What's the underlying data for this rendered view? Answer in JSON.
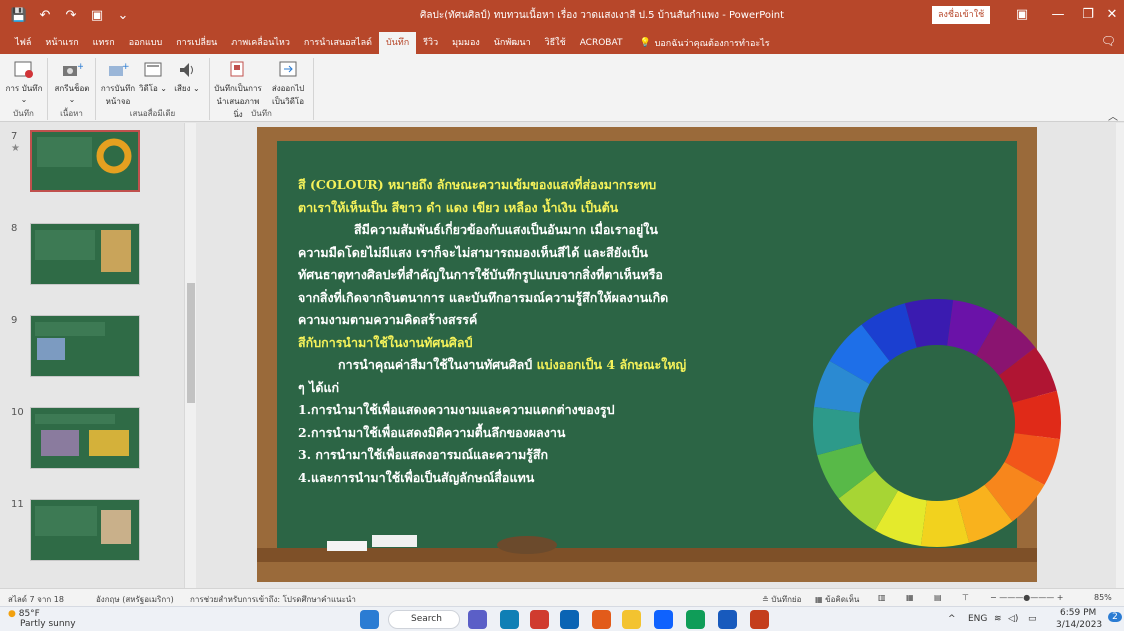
{
  "window": {
    "title": "ศิลปะ(ทัศนศิลป์) ทบทวนเนื้อหา เรื่อง วาดแสงเงาสี ป.5 บ้านสันกำแพง - PowerPoint",
    "signin": "ลงชื่อเข้าใช้",
    "quick_access": [
      "💾",
      "↶",
      "↷",
      "▣",
      "⌄"
    ],
    "controls": {
      "ribbon_display": "▣",
      "minimize": "—",
      "restore": "❐",
      "close": "✕"
    }
  },
  "tabs": [
    "ไฟล์",
    "หน้าแรก",
    "แทรก",
    "ออกแบบ",
    "การเปลี่ยน",
    "ภาพเคลื่อนไหว",
    "การนำเสนอสไลด์",
    "บันทึก",
    "รีวิว",
    "มุมมอง",
    "นักพัฒนา",
    "วิธีใช้",
    "ACROBAT"
  ],
  "active_tab_index": 7,
  "tell_me": "บอกฉันว่าคุณต้องการทำอะไร",
  "ribbon": {
    "groups": [
      {
        "label": "บันทึก",
        "buttons": [
          "การ บันทึก ⌄"
        ]
      },
      {
        "label": "เนื้อหา",
        "buttons": [
          "สกรีนช็อต ⌄"
        ]
      },
      {
        "label": "เสนอสื่อมีเดีย",
        "buttons": [
          "การบันทึก หน้าจอ",
          "วิดีโอ ⌄",
          "เสียง ⌄"
        ]
      },
      {
        "label": "บันทึก",
        "buttons": [
          "บันทึกเป็นการ นำเสนอภาพนิ่ง",
          "ส่งออกไป เป็นวิดีโอ"
        ]
      }
    ],
    "collapse": "︿"
  },
  "thumbnails": [
    {
      "number": "7",
      "star": "★",
      "selected": true
    },
    {
      "number": "8",
      "star": "",
      "selected": false
    },
    {
      "number": "9",
      "star": "",
      "selected": false
    },
    {
      "number": "10",
      "star": "",
      "selected": false
    },
    {
      "number": "11",
      "star": "",
      "selected": false
    }
  ],
  "slide": {
    "lines": [
      {
        "text": "สี (COLOUR) หมายถึง ลักษณะความเข้มของแสงที่ส่องมากระทบ",
        "style": "yellow"
      },
      {
        "text": "ตาเราให้เห็นเป็น สีขาว ดำ แดง เขียว เหลือง น้ำเงิน เป็นต้น",
        "style": "yellow"
      },
      {
        "text": "สีมีความสัมพันธ์เกี่ยวข้องกับแสงเป็นอันมาก เมื่อเราอยู่ใน",
        "style": "indent"
      },
      {
        "text": "ความมืดโดยไม่มีแสง เราก็จะไม่สามารถมองเห็นสีได้ และสียังเป็น",
        "style": "white"
      },
      {
        "text": "ทัศนธาตุทางศิลปะที่สำคัญในการใช้บันทึกรูปแบบจากสิ่งที่ตาเห็นหรือ",
        "style": "white"
      },
      {
        "text": "จากสิ่งที่เกิดจากจินตนาการ และบันทึกอารมณ์ความรู้สึกให้ผลงานเกิด",
        "style": "white"
      },
      {
        "text": "ความงามตามความคิดสร้างสรรค์",
        "style": "white"
      },
      {
        "text": "สีกับการนำมาใช้ในงานทัศนศิลป์",
        "style": "yellow"
      },
      {
        "text": "การนำคุณค่าสีมาใช้ในงานทัศนศิลป์",
        "extra": "แบ่งออกเป็น 4 ลักษณะใหญ่",
        "style": "indent-mixed"
      },
      {
        "text": "ๆ ได้แก่",
        "style": "white"
      },
      {
        "text": "1.การนำมาใช้เพื่อแสดงความงามและความแตกต่างของรูป",
        "style": "white"
      },
      {
        "text": "2.การนำมาใช้เพื่อแสดงมิติความตื้นลึกของผลงาน",
        "style": "white"
      },
      {
        "text": "3. การนำมาใช้เพื่อแสดงอารมณ์และความรู้สึก",
        "style": "white"
      },
      {
        "text": "4.และการนำมาใช้เพื่อเป็นสัญลักษณ์สื่อแทน",
        "style": "white"
      }
    ],
    "color_wheel": [
      "#1e6fe8",
      "#1b3fd0",
      "#3a1bb0",
      "#6a12a8",
      "#8a1470",
      "#b01533",
      "#e02a18",
      "#f2551a",
      "#f7861c",
      "#f9b21d",
      "#f2d21e",
      "#e4ea2c",
      "#a7d534",
      "#58b948",
      "#2d9a8a",
      "#2b8ad2"
    ],
    "board_colors": {
      "frame": "#9a6a3a",
      "chalkboard": "#2c6545"
    }
  },
  "status": {
    "slide_info": "สไลด์ 7 จาก 18",
    "language": "อังกฤษ (สหรัฐอเมริกา)",
    "accessibility": "การช่วยสำหรับการเข้าถึง: โปรดศึกษาคำแนะนำ",
    "notes": "≗ บันทึกย่อ",
    "comments": "▦ ข้อคิดเห็น",
    "zoom": "85%"
  },
  "taskbar": {
    "temperature": "85°F",
    "weather": "Partly sunny",
    "search": "Search",
    "language": "ENG",
    "time": "6:59 PM",
    "date": "3/14/2023",
    "notification_count": "2"
  }
}
